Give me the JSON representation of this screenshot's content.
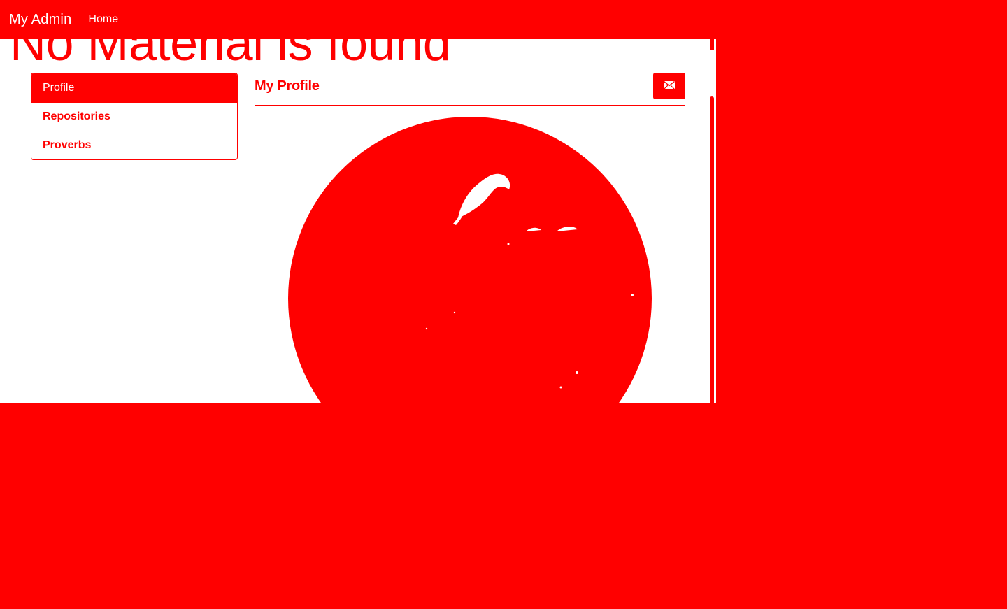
{
  "navbar": {
    "brand": "My Admin",
    "links": [
      {
        "label": "Home"
      }
    ]
  },
  "page": {
    "heading": "No Material is found"
  },
  "sidebar": {
    "items": [
      {
        "label": "Profile",
        "active": true
      },
      {
        "label": "Repositories",
        "active": false
      },
      {
        "label": "Proverbs",
        "active": false
      }
    ]
  },
  "profile": {
    "title": "My Profile",
    "mail_icon": "envelope-icon",
    "avatar_icon": "profile-photo"
  },
  "colors": {
    "accent": "#ff0000",
    "background": "#ffffff"
  }
}
